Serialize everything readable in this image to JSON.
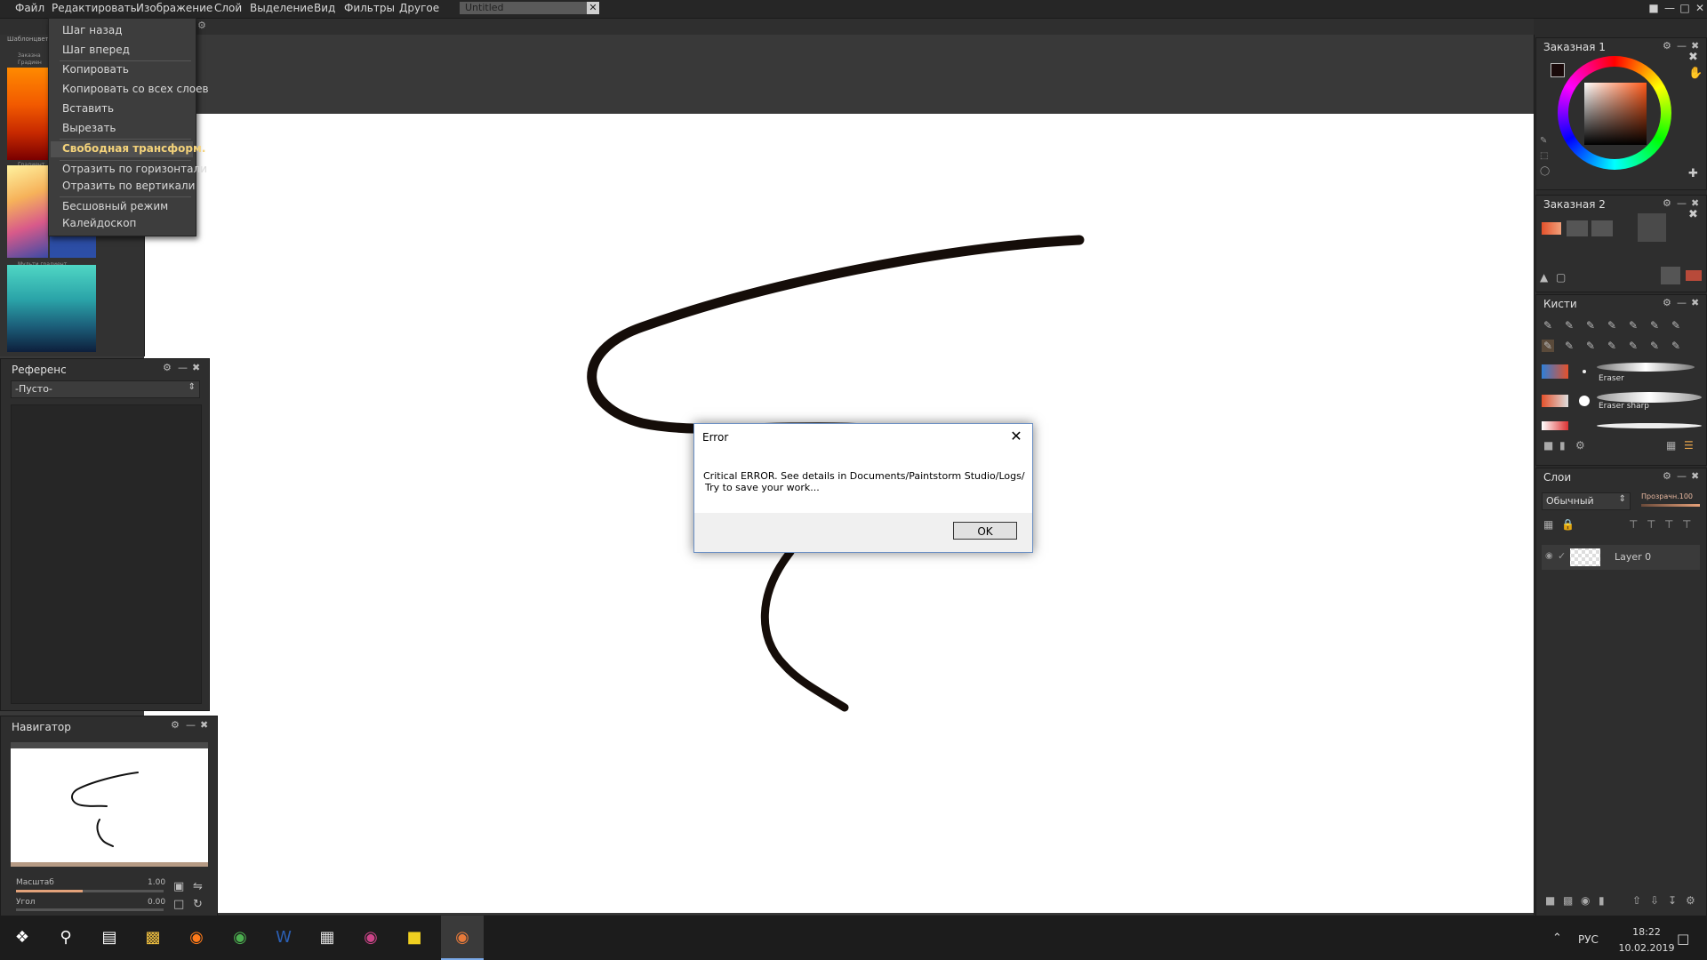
{
  "menubar": {
    "items": [
      "Файл",
      "Редактировать",
      "Изображение",
      "Слой",
      "Выделение",
      "Вид",
      "Фильтры",
      "Другое"
    ],
    "document_tab": "Untitled",
    "tab_close": "✕"
  },
  "edit_menu": {
    "items": [
      "Шаг назад",
      "Шаг вперед",
      "Копировать",
      "Копировать со всех слоев",
      "Вставить",
      "Вырезать",
      "Свободная трансформ.",
      "Отразить по горизонтали",
      "Отразить по вертикали",
      "Бесшовный режим",
      "Калейдоскоп"
    ],
    "highlighted": "Свободная трансформ."
  },
  "palette": {
    "title": "Шаблонцвет",
    "group1": "Заказна",
    "group2": "Градиен",
    "group3": "Градиент",
    "group4": "Мульти градиент"
  },
  "reference_panel": {
    "title": "Референс",
    "select_value": "-Пусто-"
  },
  "navigator_panel": {
    "title": "Навигатор",
    "scale_label": "Масштаб",
    "scale_value": "1.00",
    "angle_label": "Угол",
    "angle_value": "0.00"
  },
  "custom1_panel": {
    "title": "Заказная 1"
  },
  "custom2_panel": {
    "title": "Заказная 2"
  },
  "brushes_panel": {
    "title": "Кисти",
    "brushes": [
      "Eraser",
      "Eraser sharp"
    ]
  },
  "layers_panel": {
    "title": "Слои",
    "blend_mode": "Обычный",
    "opacity_label": "Прозрачн.100",
    "layer_name": "Layer 0"
  },
  "dialog": {
    "title": "Error",
    "message_line1": "Critical ERROR. See details in Documents/Paintstorm Studio/Logs/",
    "message_line2": "Try to save your work...",
    "ok_label": "OK"
  },
  "taskbar": {
    "language": "РУС",
    "time": "18:22",
    "date": "10.02.2019"
  },
  "colors": {
    "accent_highlight": "#f3d27a",
    "dialog_border": "#6a8fc4"
  }
}
